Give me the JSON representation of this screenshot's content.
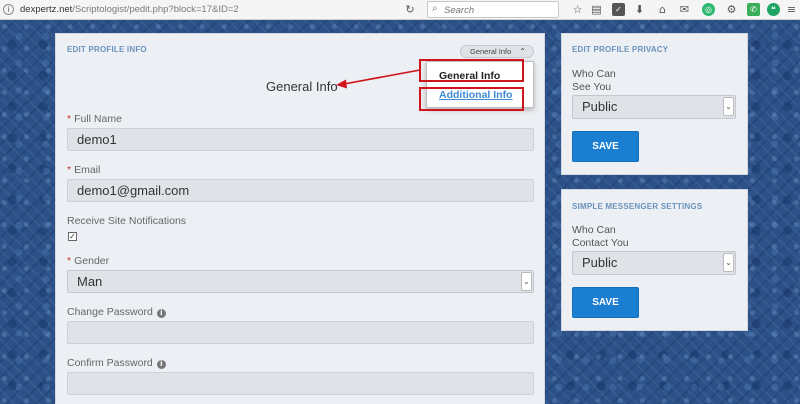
{
  "browser": {
    "url_host": "dexpertz.net",
    "url_path": "/Scriptologist/pedit.php?block=17&ID=2",
    "search_placeholder": "Search",
    "toolbar_icons": [
      "star-icon",
      "clipboard-icon",
      "pocket-icon",
      "download-icon",
      "home-icon",
      "chat-icon",
      "green-circle-icon",
      "gear-icon",
      "whatsapp-icon",
      "hangouts-icon",
      "menu-icon"
    ]
  },
  "profile": {
    "title": "EDIT PROFILE INFO",
    "tab_button_label": "General Info",
    "heading": "General Info",
    "dropdown": {
      "items": [
        "General Info",
        "Additional Info"
      ],
      "selected": "General Info"
    },
    "fields": {
      "full_name_label": "Full Name",
      "full_name_value": "demo1",
      "email_label": "Email",
      "email_value": "demo1@gmail.com",
      "notifications_label": "Receive Site Notifications",
      "notifications_checked": true,
      "gender_label": "Gender",
      "gender_value": "Man",
      "change_password_label": "Change Password",
      "confirm_password_label": "Confirm Password"
    }
  },
  "privacy": {
    "title": "EDIT PROFILE PRIVACY",
    "label_line1": "Who Can",
    "label_line2": "See You",
    "value": "Public",
    "save_label": "SAVE"
  },
  "messenger": {
    "title": "SIMPLE MESSENGER SETTINGS",
    "label_line1": "Who Can",
    "label_line2": "Contact You",
    "value": "Public",
    "save_label": "SAVE"
  },
  "colors": {
    "accent": "#1a7fd0",
    "highlight": "#d0141c",
    "link": "#3d8ad4",
    "required": "#c0392b"
  }
}
